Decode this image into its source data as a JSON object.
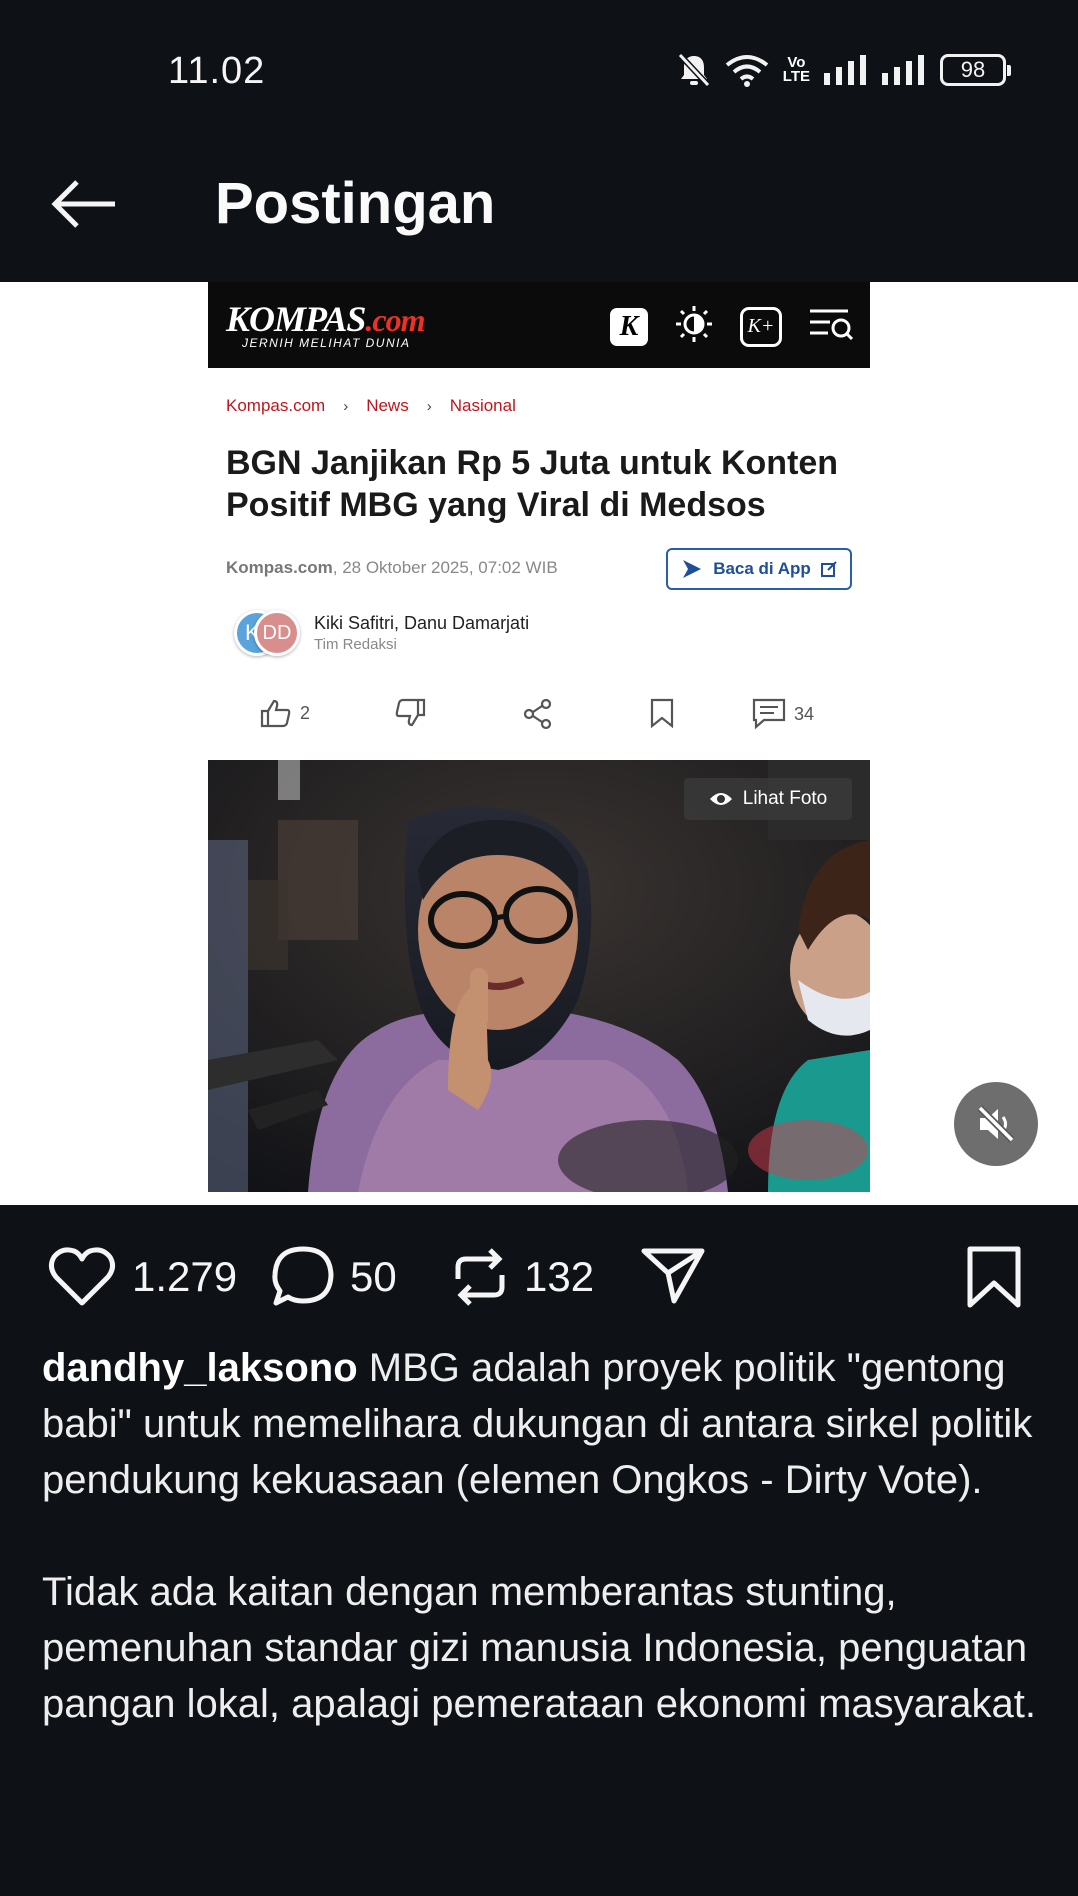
{
  "status_bar": {
    "time": "11.02",
    "volte_line1": "Vo",
    "volte_line2": "LTE",
    "battery": "98",
    "icons": [
      "bell-muted-icon",
      "wifi-icon",
      "volte-icon",
      "signal-icon",
      "signal-icon",
      "battery-icon"
    ]
  },
  "header": {
    "title": "Postingan",
    "back_icon": "arrow-left-icon"
  },
  "article": {
    "logo_main": "KOMPAS",
    "logo_suffix": ".com",
    "tagline": "JERNIH MELIHAT DUNIA",
    "tool_k": "K",
    "tool_kplus": "K+",
    "breadcrumb": [
      "Kompas.com",
      "News",
      "Nasional"
    ],
    "title": "BGN Janjikan Rp 5 Juta untuk Konten Positif MBG yang Viral di Medsos",
    "source": "Kompas.com",
    "date": ", 28 Oktober 2025, 07:02 WIB",
    "app_button": "Baca di App",
    "avatar_1": "K",
    "avatar_2": "DD",
    "authors": "Kiki Safitri,  Danu Damarjati",
    "team": "Tim Redaksi",
    "like_count": "2",
    "comment_count": "34",
    "photo_button": "Lihat Foto"
  },
  "post": {
    "likes": "1.279",
    "comments": "50",
    "reposts": "132",
    "username": "dandhy_laksono",
    "caption_p1": "MBG adalah proyek politik \"gentong babi\" untuk memelihara dukungan di antara sirkel politik pendukung kekuasaan (elemen Ongkos - Dirty Vote).",
    "caption_p2": "Tidak ada kaitan dengan memberantas stunting, pemenuhan standar gizi manusia Indonesia, penguatan pangan lokal, apalagi pemerataan ekonomi masyarakat."
  },
  "colors": {
    "background": "#0e1116",
    "breadcrumb": "#c0151c",
    "app_button": "#1f4f99",
    "kompas_red": "#ee3124"
  }
}
